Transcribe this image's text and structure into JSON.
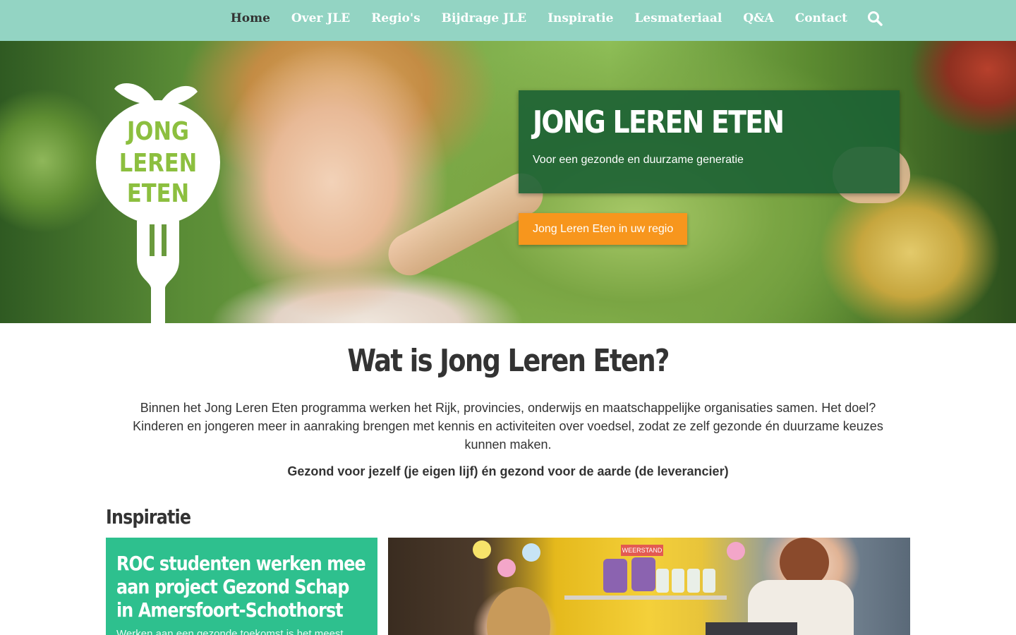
{
  "nav": {
    "items": [
      {
        "label": "Home",
        "active": true
      },
      {
        "label": "Over JLE",
        "active": false
      },
      {
        "label": "Regio's",
        "active": false
      },
      {
        "label": "Bijdrage JLE",
        "active": false
      },
      {
        "label": "Inspiratie",
        "active": false
      },
      {
        "label": "Lesmateriaal",
        "active": false
      },
      {
        "label": "Q&A",
        "active": false
      },
      {
        "label": "Contact",
        "active": false
      }
    ],
    "search_icon": "search-icon",
    "bar_color": "#93d4c3"
  },
  "logo": {
    "line1": "JONG",
    "line2": "LEREN",
    "line3": "ETEN",
    "color": "#8cbf3f"
  },
  "hero": {
    "title": "JONG LEREN ETEN",
    "subtitle": "Voor een gezonde en duurzame generatie",
    "cta_label": "Jong Leren Eten in uw regio",
    "banner_color": "#1c6234",
    "cta_color": "#f7961d"
  },
  "intro": {
    "title": "Wat is Jong Leren Eten?",
    "text": "Binnen het Jong Leren Eten programma werken het Rijk, provincies, onderwijs en maatschappelijke organisaties samen. Het doel? Kinderen en jongeren meer in aanraking brengen met kennis en activiteiten over voedsel, zodat ze zelf gezonde én duurzame keuzes kunnen maken.",
    "bold": "Gezond voor jezelf (je eigen lijf) én gezond voor de aarde (de leverancier)"
  },
  "inspiratie": {
    "heading": "Inspiratie",
    "card_title": "ROC studenten werken mee aan project Gezond Schap in Amersfoort-Schothorst",
    "card_excerpt": "Werken aan een gezonde toekomst is het meest",
    "card_color": "#2ec08e",
    "image_sign": "WEERSTAND"
  }
}
